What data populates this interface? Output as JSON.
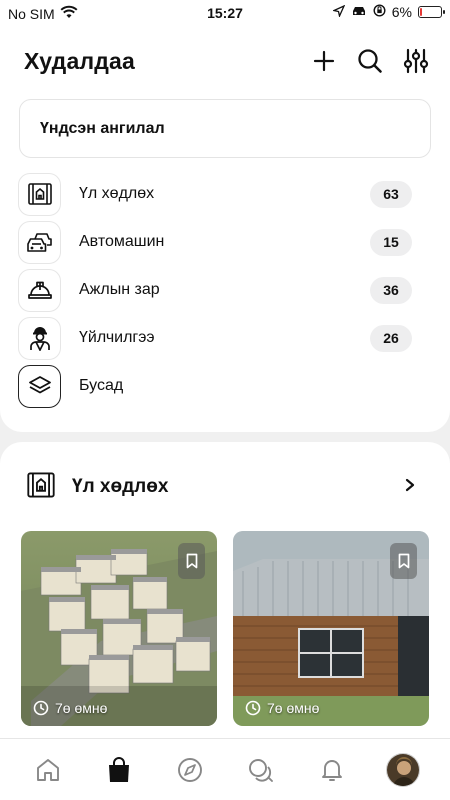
{
  "status_bar": {
    "carrier": "No SIM",
    "time": "15:27",
    "battery": "6%",
    "battery_level": 0.06,
    "icons": [
      "wifi-icon",
      "location-arrow-icon",
      "car-icon",
      "orientation-lock-icon",
      "battery-icon"
    ]
  },
  "header": {
    "title": "Худалдаа",
    "icons": [
      "plus-icon",
      "search-icon",
      "filter-sliders-icon"
    ]
  },
  "main_category": {
    "label": "Үндсэн ангилал"
  },
  "categories": [
    {
      "label": "Үл хөдлөх",
      "count": "63",
      "icon": "building-plan-icon"
    },
    {
      "label": "Автомашин",
      "count": "15",
      "icon": "cars-icon"
    },
    {
      "label": "Ажлын зар",
      "count": "36",
      "icon": "hard-hat-icon"
    },
    {
      "label": "Үйлчилгээ",
      "count": "26",
      "icon": "worker-icon"
    },
    {
      "label": "Бусад",
      "count": "",
      "icon": "layers-icon"
    }
  ],
  "section": {
    "title": "Үл хөдлөх",
    "icon": "building-plan-icon",
    "listings": [
      {
        "time_ago": "7ө өмнө",
        "image": "apartment-complex-render"
      },
      {
        "time_ago": "7ө өмнө",
        "image": "wooden-house-photo"
      }
    ]
  },
  "bottom_nav": {
    "items": [
      "home-icon",
      "shopping-bag-icon",
      "compass-icon",
      "chat-bubbles-icon",
      "bell-icon",
      "avatar"
    ],
    "active": "shopping-bag-icon"
  },
  "colors": {
    "accent": "#111111",
    "background": "#f0f0f0",
    "battery_low": "#e53935"
  }
}
